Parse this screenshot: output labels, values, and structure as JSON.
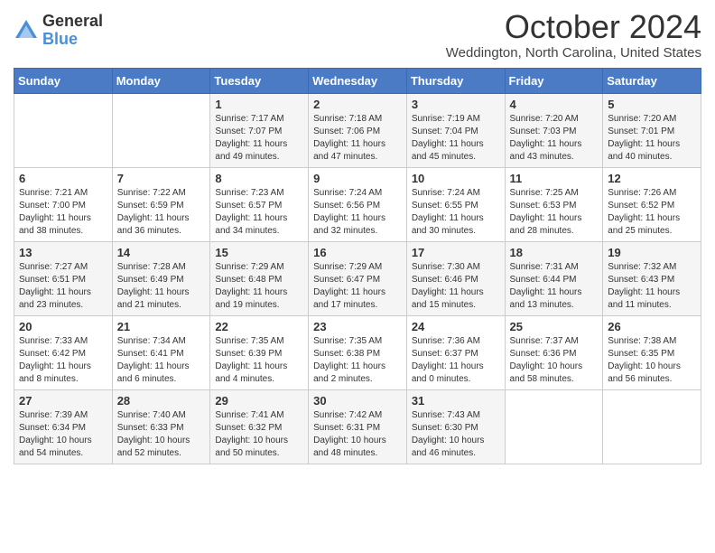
{
  "header": {
    "logo_general": "General",
    "logo_blue": "Blue",
    "month_title": "October 2024",
    "location": "Weddington, North Carolina, United States"
  },
  "days_of_week": [
    "Sunday",
    "Monday",
    "Tuesday",
    "Wednesday",
    "Thursday",
    "Friday",
    "Saturday"
  ],
  "weeks": [
    [
      {
        "day": "",
        "info": ""
      },
      {
        "day": "",
        "info": ""
      },
      {
        "day": "1",
        "info": "Sunrise: 7:17 AM\nSunset: 7:07 PM\nDaylight: 11 hours and 49 minutes."
      },
      {
        "day": "2",
        "info": "Sunrise: 7:18 AM\nSunset: 7:06 PM\nDaylight: 11 hours and 47 minutes."
      },
      {
        "day": "3",
        "info": "Sunrise: 7:19 AM\nSunset: 7:04 PM\nDaylight: 11 hours and 45 minutes."
      },
      {
        "day": "4",
        "info": "Sunrise: 7:20 AM\nSunset: 7:03 PM\nDaylight: 11 hours and 43 minutes."
      },
      {
        "day": "5",
        "info": "Sunrise: 7:20 AM\nSunset: 7:01 PM\nDaylight: 11 hours and 40 minutes."
      }
    ],
    [
      {
        "day": "6",
        "info": "Sunrise: 7:21 AM\nSunset: 7:00 PM\nDaylight: 11 hours and 38 minutes."
      },
      {
        "day": "7",
        "info": "Sunrise: 7:22 AM\nSunset: 6:59 PM\nDaylight: 11 hours and 36 minutes."
      },
      {
        "day": "8",
        "info": "Sunrise: 7:23 AM\nSunset: 6:57 PM\nDaylight: 11 hours and 34 minutes."
      },
      {
        "day": "9",
        "info": "Sunrise: 7:24 AM\nSunset: 6:56 PM\nDaylight: 11 hours and 32 minutes."
      },
      {
        "day": "10",
        "info": "Sunrise: 7:24 AM\nSunset: 6:55 PM\nDaylight: 11 hours and 30 minutes."
      },
      {
        "day": "11",
        "info": "Sunrise: 7:25 AM\nSunset: 6:53 PM\nDaylight: 11 hours and 28 minutes."
      },
      {
        "day": "12",
        "info": "Sunrise: 7:26 AM\nSunset: 6:52 PM\nDaylight: 11 hours and 25 minutes."
      }
    ],
    [
      {
        "day": "13",
        "info": "Sunrise: 7:27 AM\nSunset: 6:51 PM\nDaylight: 11 hours and 23 minutes."
      },
      {
        "day": "14",
        "info": "Sunrise: 7:28 AM\nSunset: 6:49 PM\nDaylight: 11 hours and 21 minutes."
      },
      {
        "day": "15",
        "info": "Sunrise: 7:29 AM\nSunset: 6:48 PM\nDaylight: 11 hours and 19 minutes."
      },
      {
        "day": "16",
        "info": "Sunrise: 7:29 AM\nSunset: 6:47 PM\nDaylight: 11 hours and 17 minutes."
      },
      {
        "day": "17",
        "info": "Sunrise: 7:30 AM\nSunset: 6:46 PM\nDaylight: 11 hours and 15 minutes."
      },
      {
        "day": "18",
        "info": "Sunrise: 7:31 AM\nSunset: 6:44 PM\nDaylight: 11 hours and 13 minutes."
      },
      {
        "day": "19",
        "info": "Sunrise: 7:32 AM\nSunset: 6:43 PM\nDaylight: 11 hours and 11 minutes."
      }
    ],
    [
      {
        "day": "20",
        "info": "Sunrise: 7:33 AM\nSunset: 6:42 PM\nDaylight: 11 hours and 8 minutes."
      },
      {
        "day": "21",
        "info": "Sunrise: 7:34 AM\nSunset: 6:41 PM\nDaylight: 11 hours and 6 minutes."
      },
      {
        "day": "22",
        "info": "Sunrise: 7:35 AM\nSunset: 6:39 PM\nDaylight: 11 hours and 4 minutes."
      },
      {
        "day": "23",
        "info": "Sunrise: 7:35 AM\nSunset: 6:38 PM\nDaylight: 11 hours and 2 minutes."
      },
      {
        "day": "24",
        "info": "Sunrise: 7:36 AM\nSunset: 6:37 PM\nDaylight: 11 hours and 0 minutes."
      },
      {
        "day": "25",
        "info": "Sunrise: 7:37 AM\nSunset: 6:36 PM\nDaylight: 10 hours and 58 minutes."
      },
      {
        "day": "26",
        "info": "Sunrise: 7:38 AM\nSunset: 6:35 PM\nDaylight: 10 hours and 56 minutes."
      }
    ],
    [
      {
        "day": "27",
        "info": "Sunrise: 7:39 AM\nSunset: 6:34 PM\nDaylight: 10 hours and 54 minutes."
      },
      {
        "day": "28",
        "info": "Sunrise: 7:40 AM\nSunset: 6:33 PM\nDaylight: 10 hours and 52 minutes."
      },
      {
        "day": "29",
        "info": "Sunrise: 7:41 AM\nSunset: 6:32 PM\nDaylight: 10 hours and 50 minutes."
      },
      {
        "day": "30",
        "info": "Sunrise: 7:42 AM\nSunset: 6:31 PM\nDaylight: 10 hours and 48 minutes."
      },
      {
        "day": "31",
        "info": "Sunrise: 7:43 AM\nSunset: 6:30 PM\nDaylight: 10 hours and 46 minutes."
      },
      {
        "day": "",
        "info": ""
      },
      {
        "day": "",
        "info": ""
      }
    ]
  ]
}
